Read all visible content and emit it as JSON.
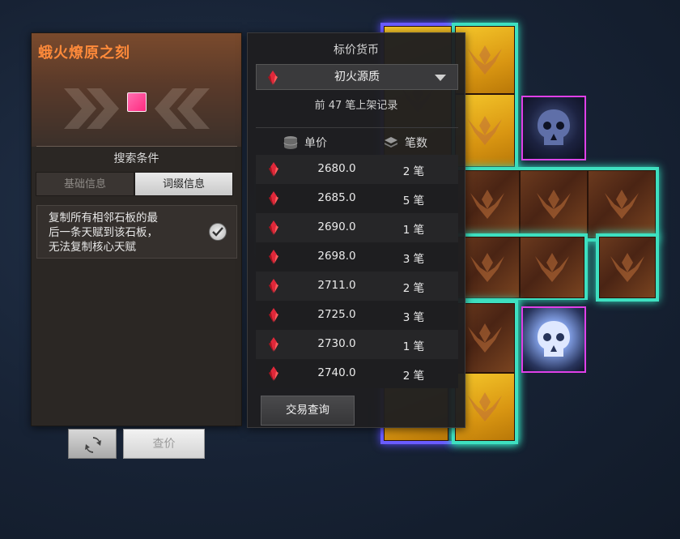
{
  "item": {
    "title": "蛾火燎原之刻",
    "color": "#ff8a3a"
  },
  "search": {
    "label": "搜索条件",
    "tabs": [
      "基础信息",
      "词缀信息"
    ],
    "active_tab": "词缀信息",
    "affix": {
      "lines": [
        "复制所有相邻石板的最",
        "后一条天赋到该石板，",
        "无法复制核心天赋"
      ],
      "checked": true
    }
  },
  "buttons": {
    "reset_icon": "refresh-icon",
    "price_check": "查价",
    "trade_query": "交易查询"
  },
  "currency": {
    "label": "标价货币",
    "selected": "初火源质",
    "icon": "red-crystal-icon"
  },
  "records": {
    "summary": "前 47 笔上架记录",
    "columns": {
      "price": "单价",
      "count": "笔数"
    },
    "rows": [
      {
        "price": "2680.0",
        "count": "2 笔"
      },
      {
        "price": "2685.0",
        "count": "5 笔"
      },
      {
        "price": "2690.0",
        "count": "1 笔"
      },
      {
        "price": "2698.0",
        "count": "3 笔"
      },
      {
        "price": "2711.0",
        "count": "2 笔"
      },
      {
        "price": "2725.0",
        "count": "3 笔"
      },
      {
        "price": "2730.0",
        "count": "1 笔"
      },
      {
        "price": "2740.0",
        "count": "2 笔"
      }
    ]
  }
}
